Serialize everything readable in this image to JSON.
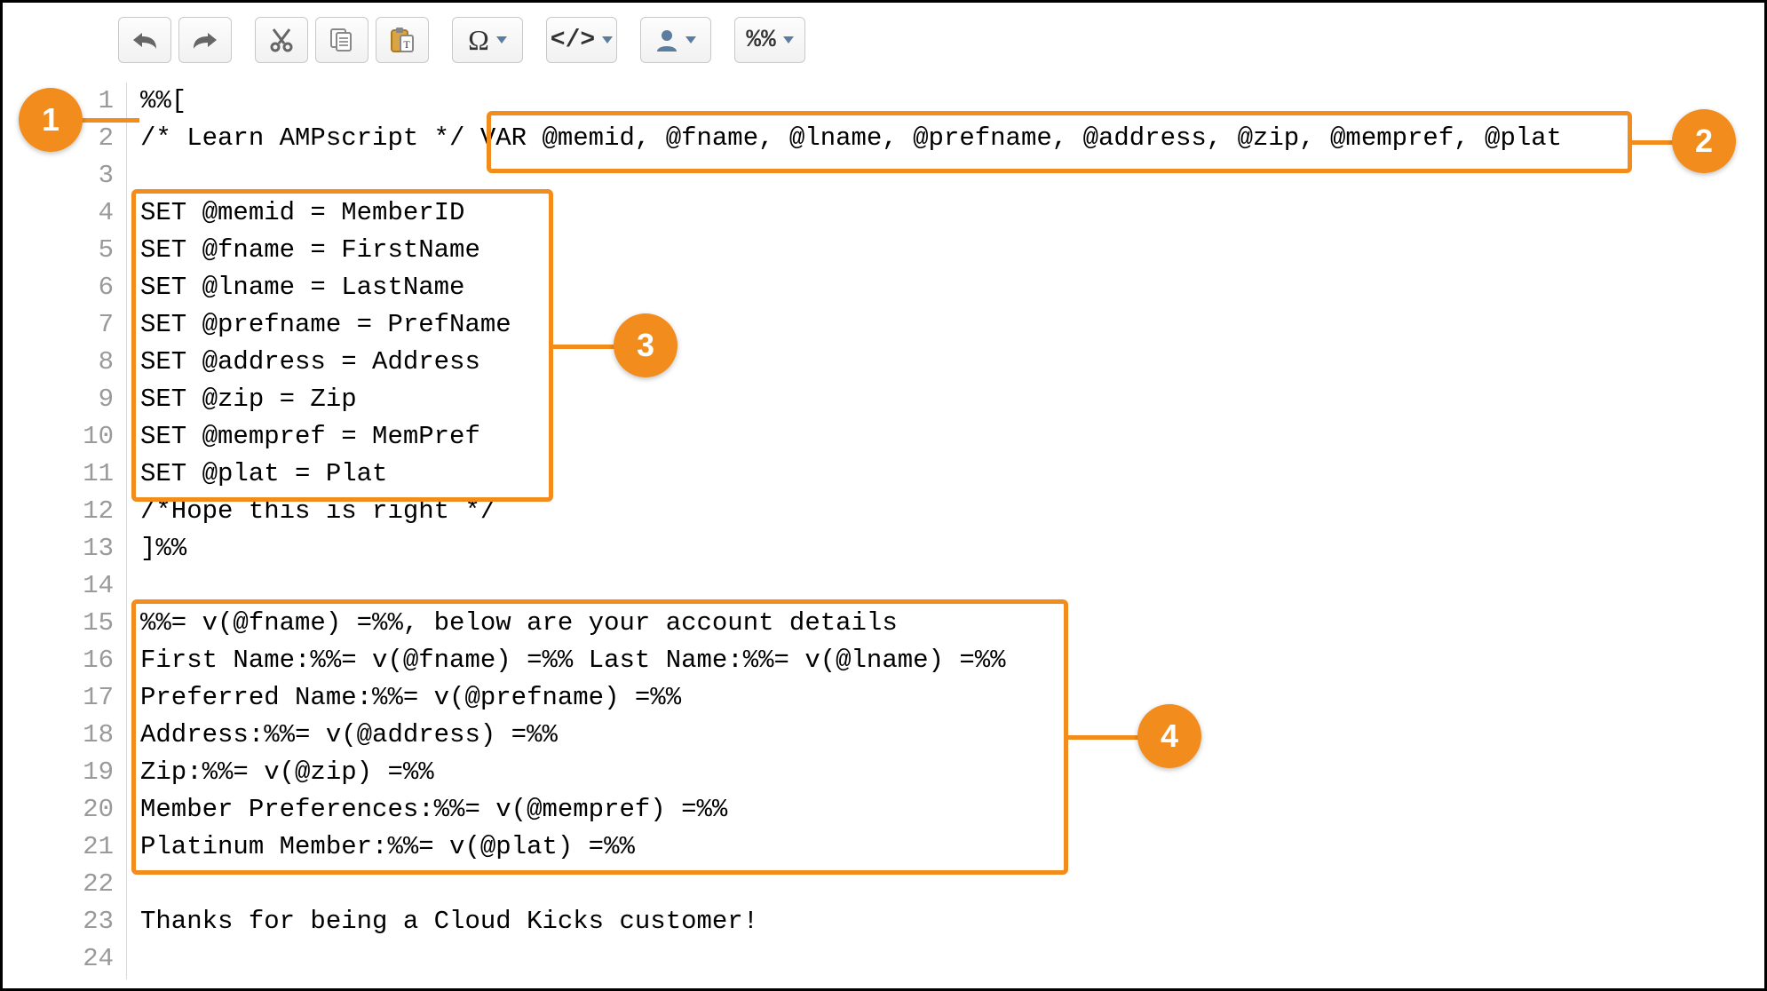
{
  "toolbar": {
    "undo": {
      "name": "undo-icon"
    },
    "redo": {
      "name": "redo-icon"
    },
    "cut": {
      "name": "cut-icon"
    },
    "copy": {
      "name": "copy-icon"
    },
    "paste": {
      "name": "paste-text-icon"
    },
    "omega": {
      "label": "Ω"
    },
    "source": {
      "label": "</>"
    },
    "user": {
      "name": "user-icon"
    },
    "percent": {
      "label": "%%"
    }
  },
  "code_lines": [
    "%%[",
    "/* Learn AMPscript */ VAR @memid, @fname, @lname, @prefname, @address, @zip, @mempref, @plat",
    "",
    "SET @memid = MemberID",
    "SET @fname = FirstName",
    "SET @lname = LastName",
    "SET @prefname = PrefName",
    "SET @address = Address",
    "SET @zip = Zip",
    "SET @mempref = MemPref",
    "SET @plat = Plat",
    "/*Hope this is right */",
    "]%%",
    "",
    "%%= v(@fname) =%%, below are your account details",
    "First Name:%%= v(@fname) =%% Last Name:%%= v(@lname) =%%",
    "Preferred Name:%%= v(@prefname) =%%",
    "Address:%%= v(@address) =%%",
    "Zip:%%= v(@zip) =%%",
    "Member Preferences:%%= v(@mempref) =%%",
    "Platinum Member:%%= v(@plat) =%%",
    "",
    "Thanks for being a Cloud Kicks customer!",
    ""
  ],
  "line_numbers": [
    "1",
    "2",
    "3",
    "4",
    "5",
    "6",
    "7",
    "8",
    "9",
    "10",
    "11",
    "12",
    "13",
    "14",
    "15",
    "16",
    "17",
    "18",
    "19",
    "20",
    "21",
    "22",
    "23",
    "24"
  ],
  "callouts": {
    "c1": "1",
    "c2": "2",
    "c3": "3",
    "c4": "4"
  },
  "colors": {
    "accent": "#f28c1c"
  }
}
